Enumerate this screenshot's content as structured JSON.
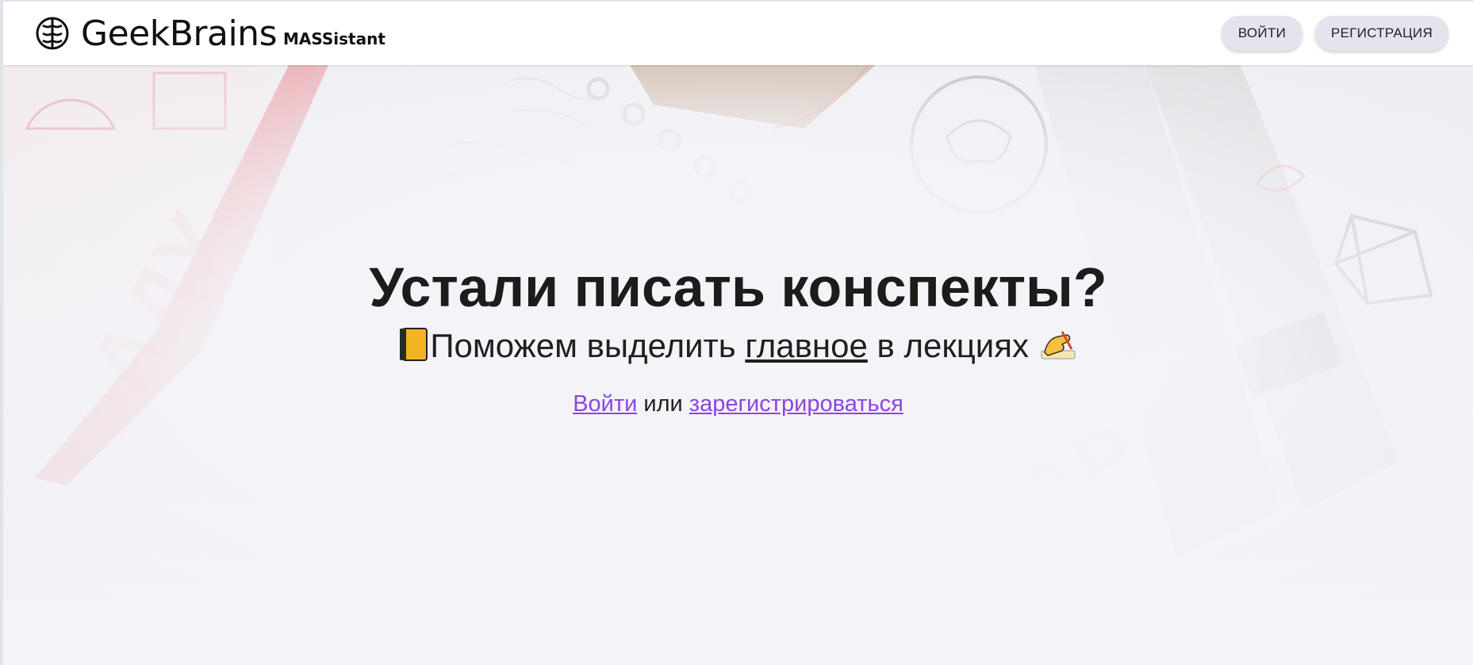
{
  "header": {
    "logo_text": "GeekBrains",
    "logo_sub": "MASSistant",
    "login_label": "ВОЙТИ",
    "register_label": "РЕГИСТРАЦИЯ"
  },
  "hero": {
    "title": "Устали писать конспекты?",
    "subtitle_before": "Поможем выделить ",
    "subtitle_emph": "главное",
    "subtitle_after": " в лекциях",
    "emoji_left": "notebook-icon",
    "emoji_right": "writing-hand-icon",
    "cta_login": "Войти",
    "cta_or": " или ",
    "cta_register": "зарегистрироваться"
  },
  "colors": {
    "accent_link": "#8b46e0",
    "button_bg": "#e4e4ec",
    "text_dark": "#1c1c1c"
  }
}
